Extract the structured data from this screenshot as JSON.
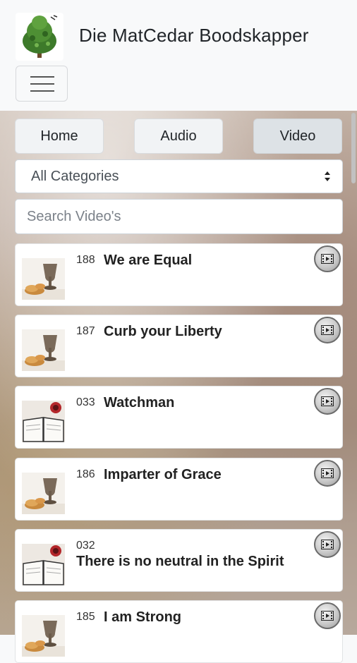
{
  "header": {
    "title": "Die MatCedar Boodskapper",
    "logo_icon": "cedar-tree-icon",
    "menu_icon": "hamburger-menu-icon"
  },
  "nav": {
    "home_label": "Home",
    "audio_label": "Audio",
    "video_label": "Video",
    "active": "Video"
  },
  "filters": {
    "category_selected": "All Categories",
    "search_placeholder": "Search Video's"
  },
  "videos": [
    {
      "number": "188",
      "title": "We are Equal",
      "thumb": "communion-cup-bread"
    },
    {
      "number": "187",
      "title": "Curb your Liberty",
      "thumb": "communion-cup-bread"
    },
    {
      "number": "033",
      "title": "Watchman",
      "thumb": "open-bible-red-cup"
    },
    {
      "number": "186",
      "title": "Imparter of Grace",
      "thumb": "communion-cup-bread"
    },
    {
      "number": "032",
      "title": "There is no neutral in the Spirit",
      "thumb": "open-bible-red-cup"
    },
    {
      "number": "185",
      "title": "I am Strong",
      "thumb": "communion-cup-bread"
    }
  ],
  "colors": {
    "header_bg": "#f8f9fa",
    "button_bg": "#f1f3f5",
    "active_button_bg": "#dde2e6",
    "card_bg": "#ffffff"
  }
}
